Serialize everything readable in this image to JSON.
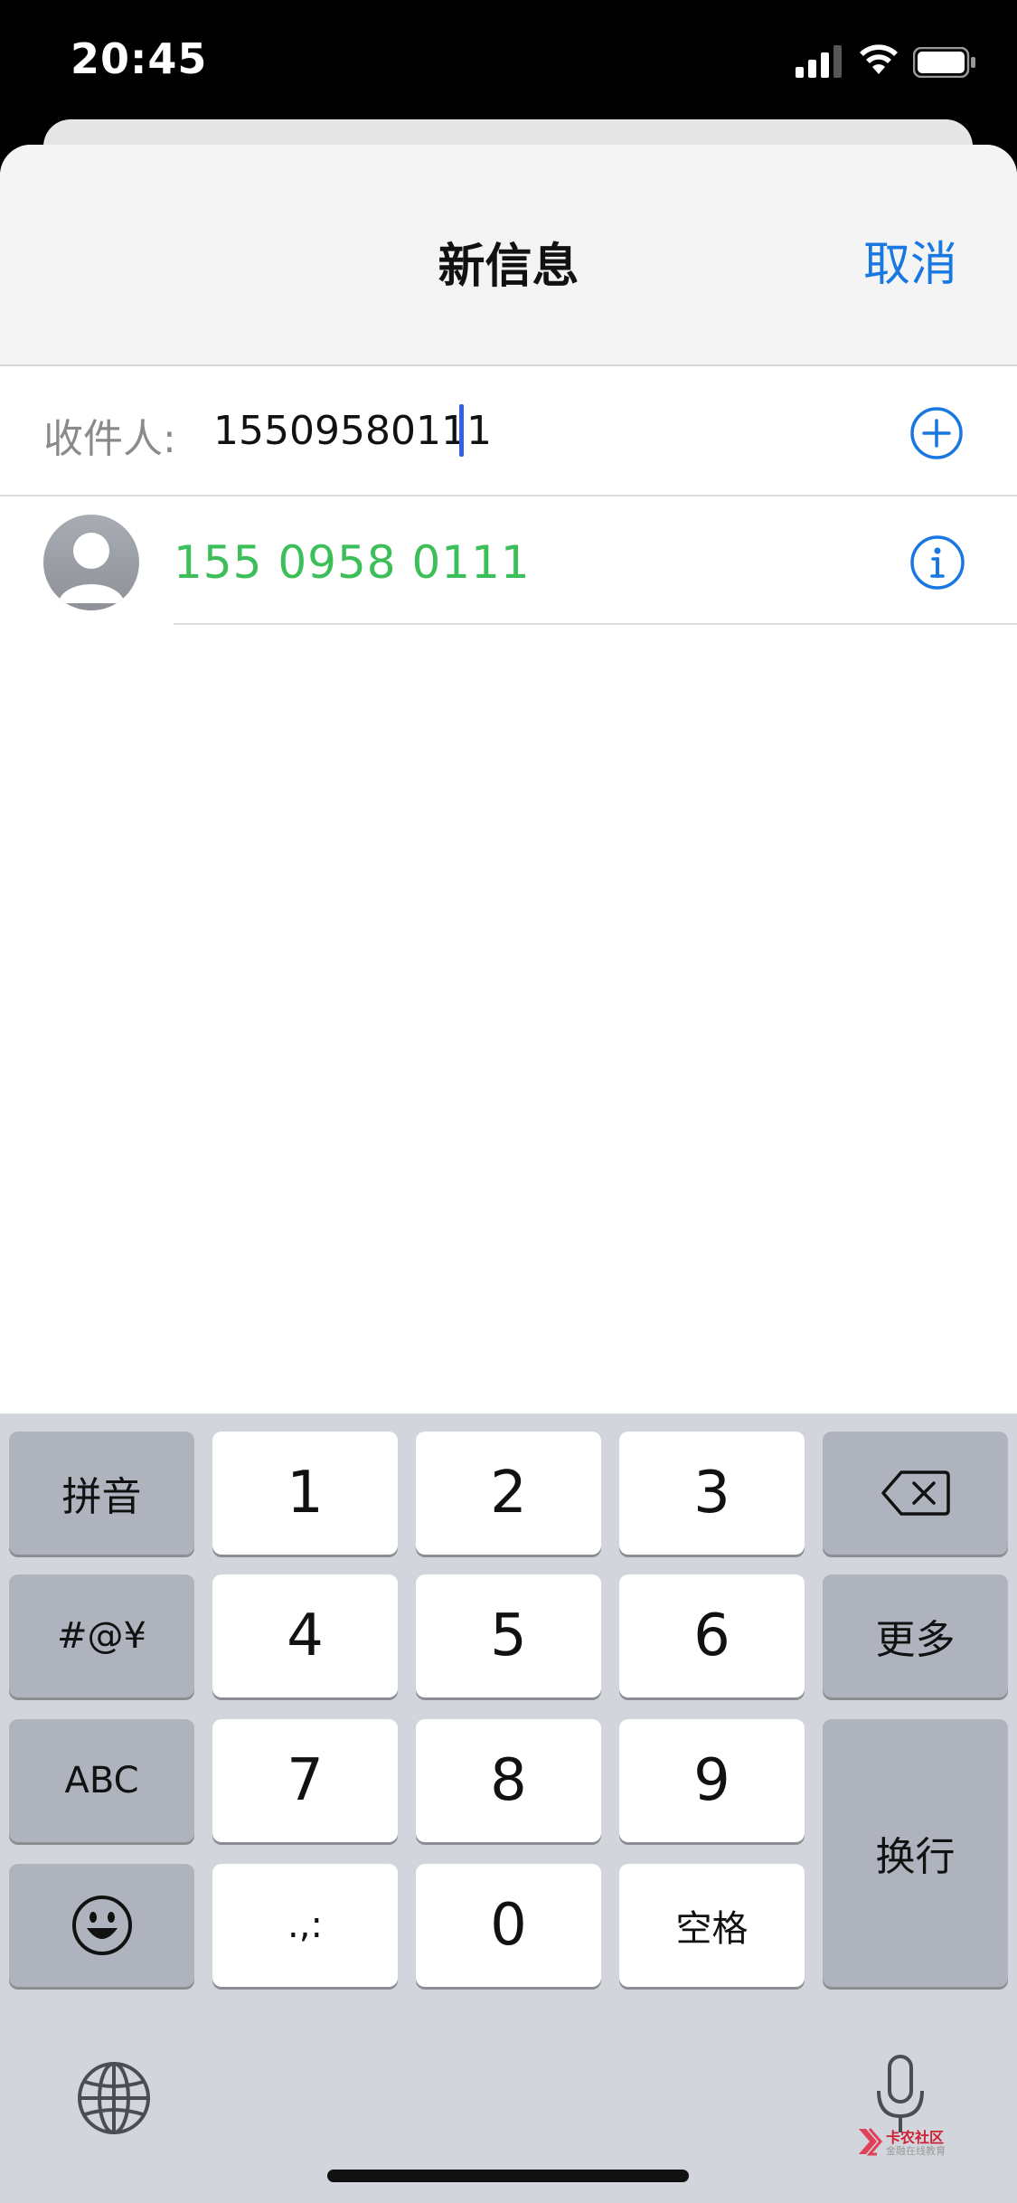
{
  "status": {
    "time": "20:45"
  },
  "nav": {
    "title": "新信息",
    "cancel": "取消"
  },
  "recipient": {
    "label": "收件人:",
    "value": "15509580111"
  },
  "suggestion": {
    "number": "155 0958 0111"
  },
  "keyboard": {
    "pinyin": "拼音",
    "symbols": "#@¥",
    "abc": "ABC",
    "more": "更多",
    "return": "换行",
    "space": "空格",
    "punct": ".,:",
    "digits": [
      "1",
      "2",
      "3",
      "4",
      "5",
      "6",
      "7",
      "8",
      "9",
      "0"
    ]
  },
  "watermark": {
    "text": "卡农社区",
    "sub": "金融在线教育"
  },
  "colors": {
    "accent": "#1877e0",
    "green": "#3cbf59",
    "caret": "#2f62e8"
  }
}
